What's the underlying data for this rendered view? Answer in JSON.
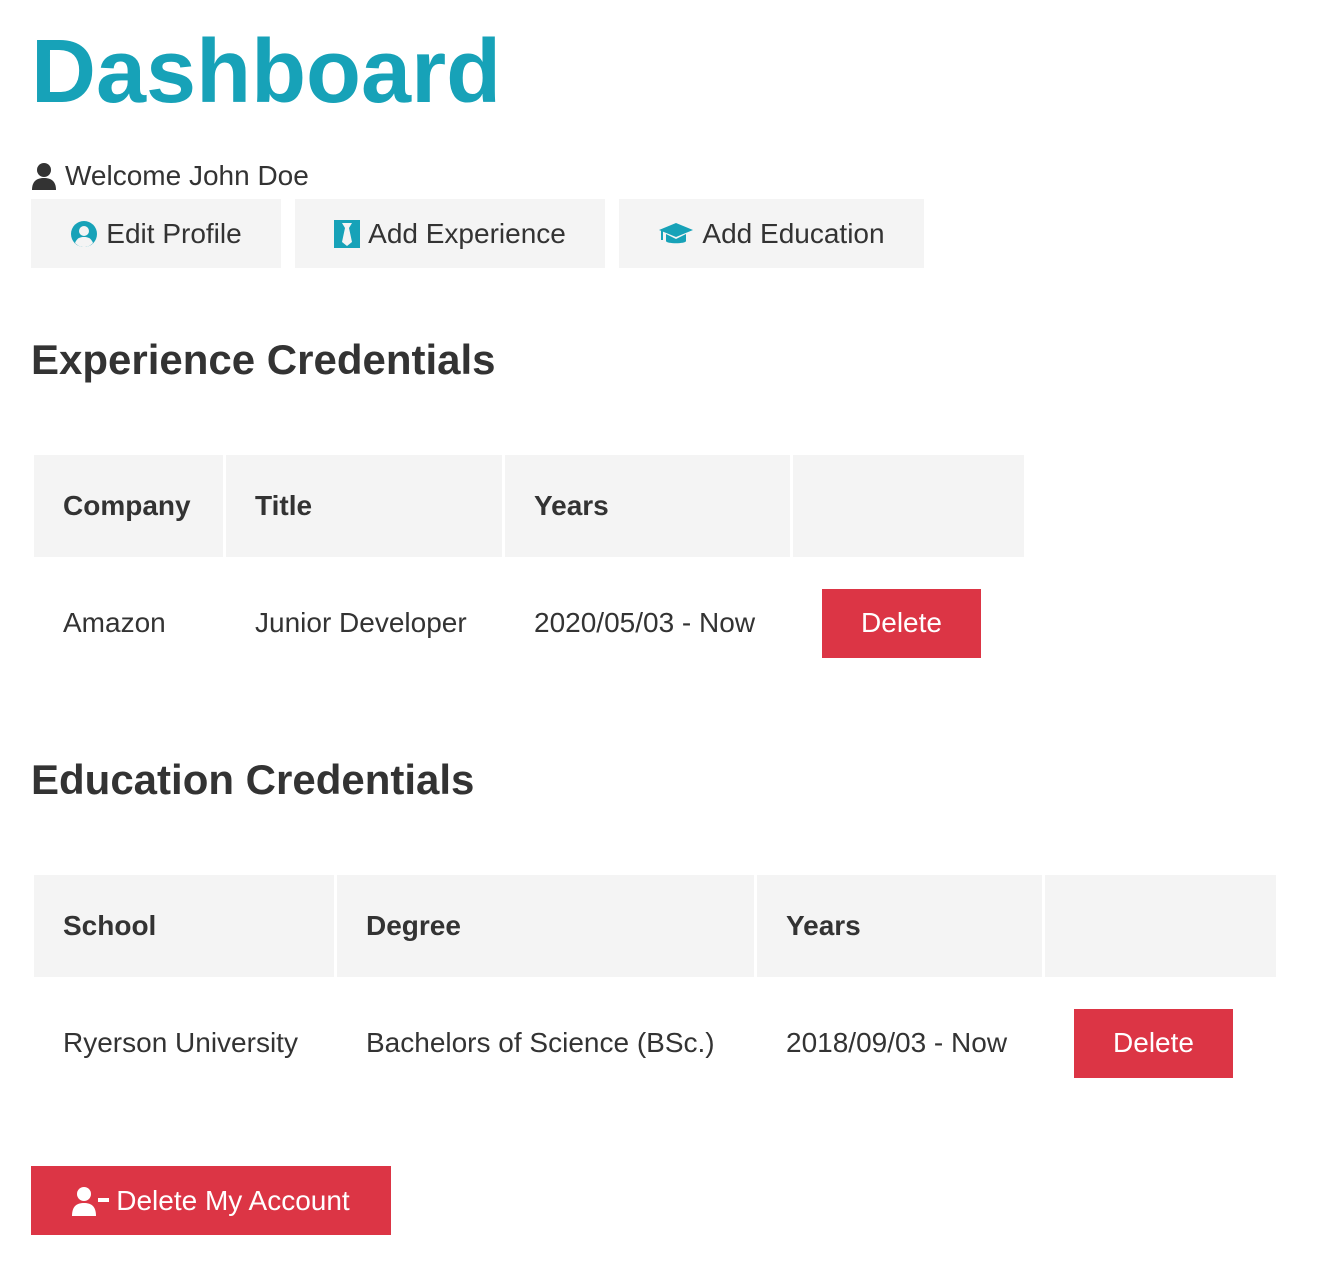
{
  "header": {
    "title": "Dashboard",
    "welcome_text": "Welcome John Doe",
    "user_icon": "user-icon"
  },
  "actions": {
    "edit_profile": {
      "label": "Edit Profile",
      "icon": "user-circle-icon"
    },
    "add_experience": {
      "label": "Add Experience",
      "icon": "black-tie-icon"
    },
    "add_education": {
      "label": "Add Education",
      "icon": "graduation-cap-icon"
    }
  },
  "experience": {
    "heading": "Experience Credentials",
    "columns": [
      "Company",
      "Title",
      "Years",
      ""
    ],
    "rows": [
      {
        "company": "Amazon",
        "title": "Junior Developer",
        "years": "2020/05/03 - Now",
        "delete_label": "Delete"
      }
    ]
  },
  "education": {
    "heading": "Education Credentials",
    "columns": [
      "School",
      "Degree",
      "Years",
      ""
    ],
    "rows": [
      {
        "school": "Ryerson University",
        "degree": "Bachelors of Science (BSc.)",
        "years": "2018/09/03 - Now",
        "delete_label": "Delete"
      }
    ]
  },
  "danger_zone": {
    "delete_account_label": "Delete My Account",
    "icon": "user-minus-icon"
  },
  "colors": {
    "primary": "#17a2b8",
    "danger": "#dc3545",
    "light": "#f4f4f4",
    "text": "#333333"
  }
}
